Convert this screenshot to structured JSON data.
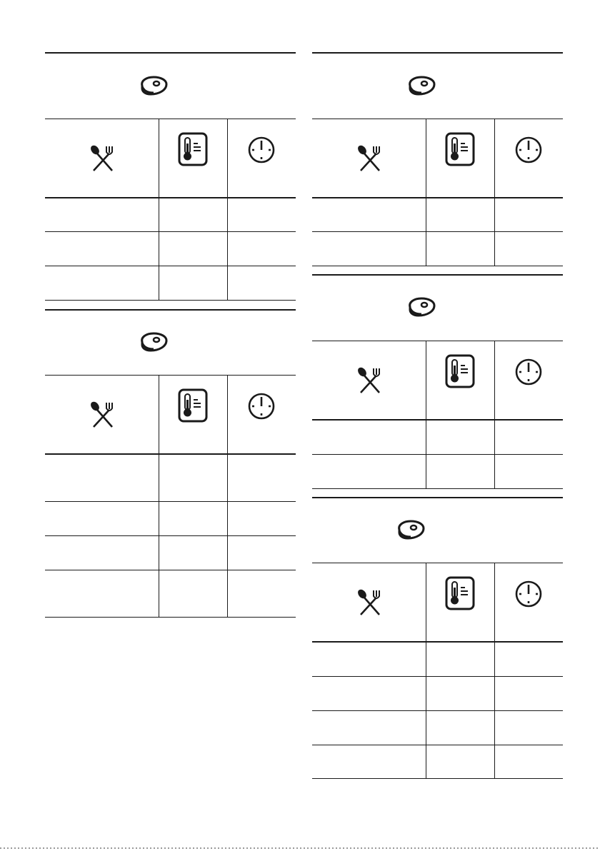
{
  "page": {
    "theme": {
      "ink": "#1a1a1a",
      "background": "#ffffff"
    },
    "icons": {
      "food": "food-icon",
      "food_type": "spoon-fork-icon",
      "temperature": "thermometer-icon",
      "time": "clock-icon"
    },
    "tables": [
      {
        "id": "left-top",
        "header_row_count": 1,
        "body_rows": 3
      },
      {
        "id": "left-bottom",
        "header_row_count": 1,
        "body_rows": 4
      },
      {
        "id": "right-1",
        "header_row_count": 1,
        "body_rows": 2
      },
      {
        "id": "right-2",
        "header_row_count": 1,
        "body_rows": 2
      },
      {
        "id": "right-3",
        "header_row_count": 1,
        "body_rows": 4
      }
    ]
  }
}
